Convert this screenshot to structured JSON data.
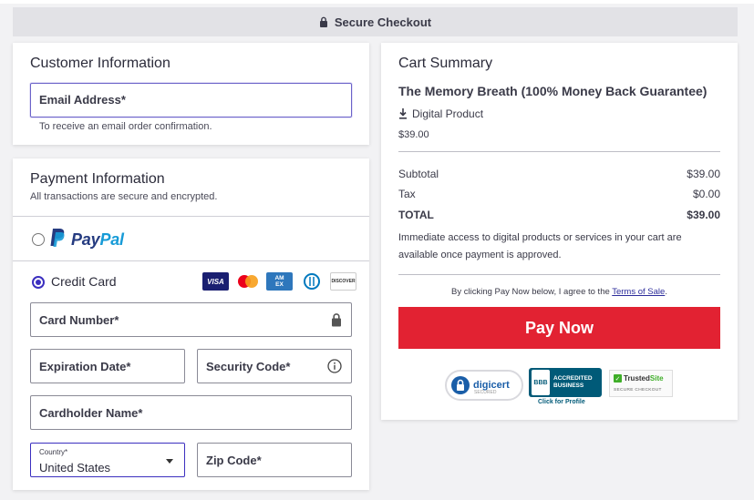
{
  "banner": {
    "label": "Secure Checkout",
    "icon": "lock-icon"
  },
  "customer": {
    "title": "Customer Information",
    "email_placeholder": "Email Address*",
    "email_help": "To receive an email order confirmation."
  },
  "payment": {
    "title": "Payment Information",
    "subtitle": "All transactions are secure and encrypted.",
    "paypal": {
      "word1": "Pay",
      "word2": "Pal",
      "selected": false
    },
    "credit_card": {
      "label": "Credit Card",
      "selected": true,
      "logos": [
        "VISA",
        "Mastercard",
        "AMEX",
        "Diners Club",
        "DISCOVER"
      ]
    },
    "fields": {
      "card_number": "Card Number*",
      "expiration": "Expiration Date*",
      "security_code": "Security Code*",
      "cardholder": "Cardholder Name*",
      "country_label": "Country*",
      "country_value": "United States",
      "zip": "Zip Code*"
    }
  },
  "cart": {
    "title": "Cart Summary",
    "product_name": "The Memory Breath (100% Money Back Guarantee)",
    "product_type": "Digital Product",
    "product_price": "$39.00",
    "subtotal_label": "Subtotal",
    "subtotal_value": "$39.00",
    "tax_label": "Tax",
    "tax_value": "$0.00",
    "total_label": "TOTAL",
    "total_value": "$39.00",
    "access_note": "Immediate access to digital products or services in your cart are available once payment is approved.",
    "terms_prefix": "By clicking Pay Now below, I agree to the ",
    "terms_link": "Terms of Sale",
    "terms_suffix": ".",
    "pay_button": "Pay Now"
  },
  "badges": {
    "digicert": "digicert",
    "digicert_sub": "SECURED",
    "bbb_seal": "BBB",
    "bbb_line1": "ACCREDITED",
    "bbb_line2": "BUSINESS",
    "bbb_click": "Click for Profile",
    "trusted_word1": "Trusted",
    "trusted_word2": "Site",
    "trusted_sub": "SECURE CHECKOUT"
  },
  "colors": {
    "accent": "#3b2fbf",
    "pay_button": "#e22232",
    "paypal_dark": "#253b80",
    "paypal_light": "#179bd7"
  }
}
